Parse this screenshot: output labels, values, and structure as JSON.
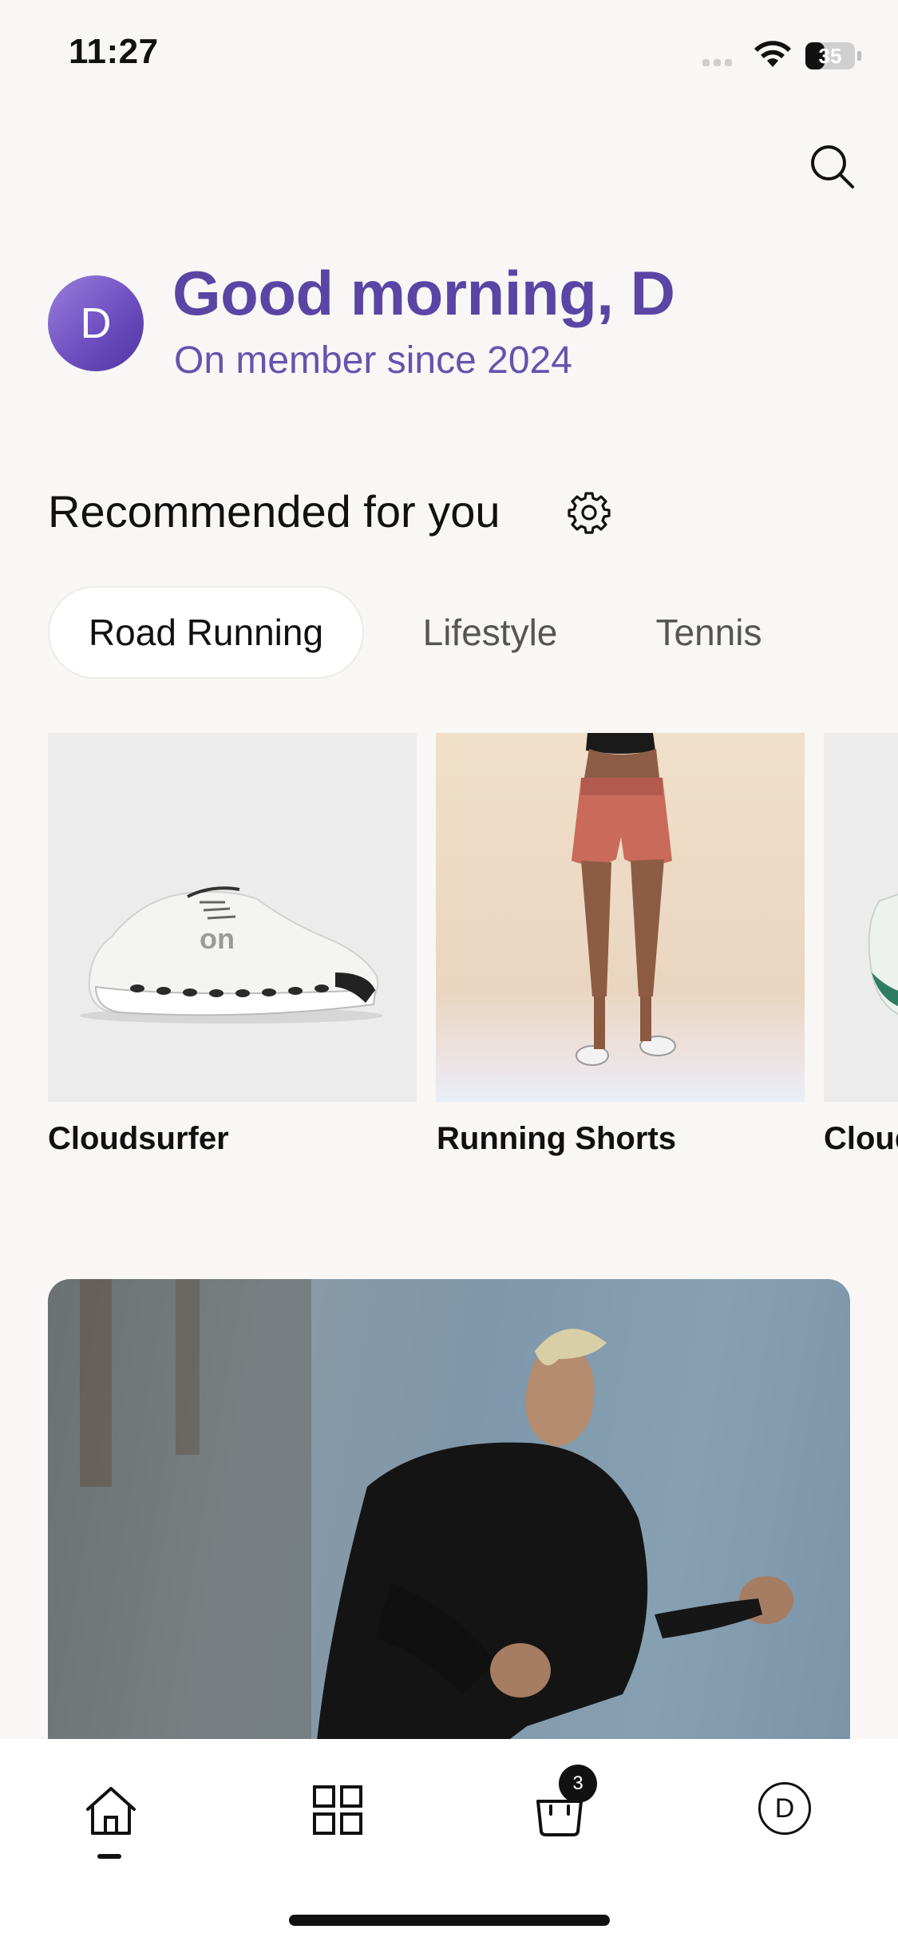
{
  "status_bar": {
    "time": "11:27",
    "battery": "35"
  },
  "header": {
    "avatar_initial": "D",
    "greeting": "Good morning, D",
    "member_since": "On member since 2024"
  },
  "recommended": {
    "title": "Recommended for you",
    "chips": [
      "Road Running",
      "Lifestyle",
      "Tennis"
    ],
    "active_chip": "Road Running"
  },
  "products": [
    {
      "name": "Cloudsurfer"
    },
    {
      "name": "Running Shorts"
    },
    {
      "name": "Cloudsurfer"
    }
  ],
  "tab_bar": {
    "items": [
      "home",
      "grid",
      "bag",
      "profile"
    ],
    "bag_count": "3",
    "profile_initial": "D"
  },
  "colors": {
    "accent": "#5a45a5",
    "background": "#f8f7f5"
  }
}
